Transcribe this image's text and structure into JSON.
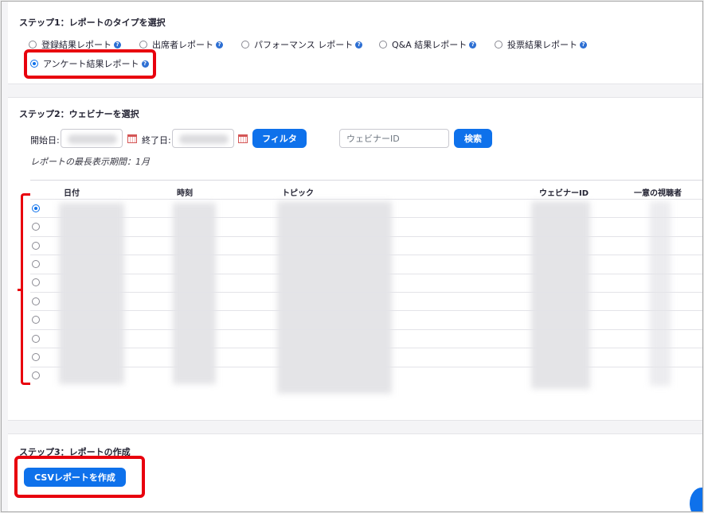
{
  "step1": {
    "title": "ステップ1：レポートのタイプを選択",
    "options": [
      {
        "label": "登録結果レポート",
        "selected": false
      },
      {
        "label": "出席者レポート",
        "selected": false
      },
      {
        "label": "パフォーマンス レポート",
        "selected": false
      },
      {
        "label": "Q&A 結果レポート",
        "selected": false
      },
      {
        "label": "投票結果レポート",
        "selected": false
      },
      {
        "label": "アンケート結果レポート",
        "selected": true
      }
    ],
    "help_icon": "question-circle-icon"
  },
  "step2": {
    "title": "ステップ2：ウェビナーを選択",
    "start_label": "開始日:",
    "end_label": "終了日:",
    "filter_button": "フィルタ",
    "webinar_id_placeholder": "ウェビナーID",
    "search_button": "検索",
    "note": "レポートの最長表示期間：1月",
    "columns": [
      "日付",
      "時刻",
      "トピック",
      "ウェビナーID",
      "一意の視聴者"
    ],
    "row_count": 10,
    "selected_row": 0
  },
  "step3": {
    "title": "ステップ3：レポートの作成",
    "generate_button": "CSVレポートを作成"
  },
  "colors": {
    "accent": "#0e71eb",
    "highlight": "#e8000d",
    "help_icon": "#2d6fd3"
  }
}
